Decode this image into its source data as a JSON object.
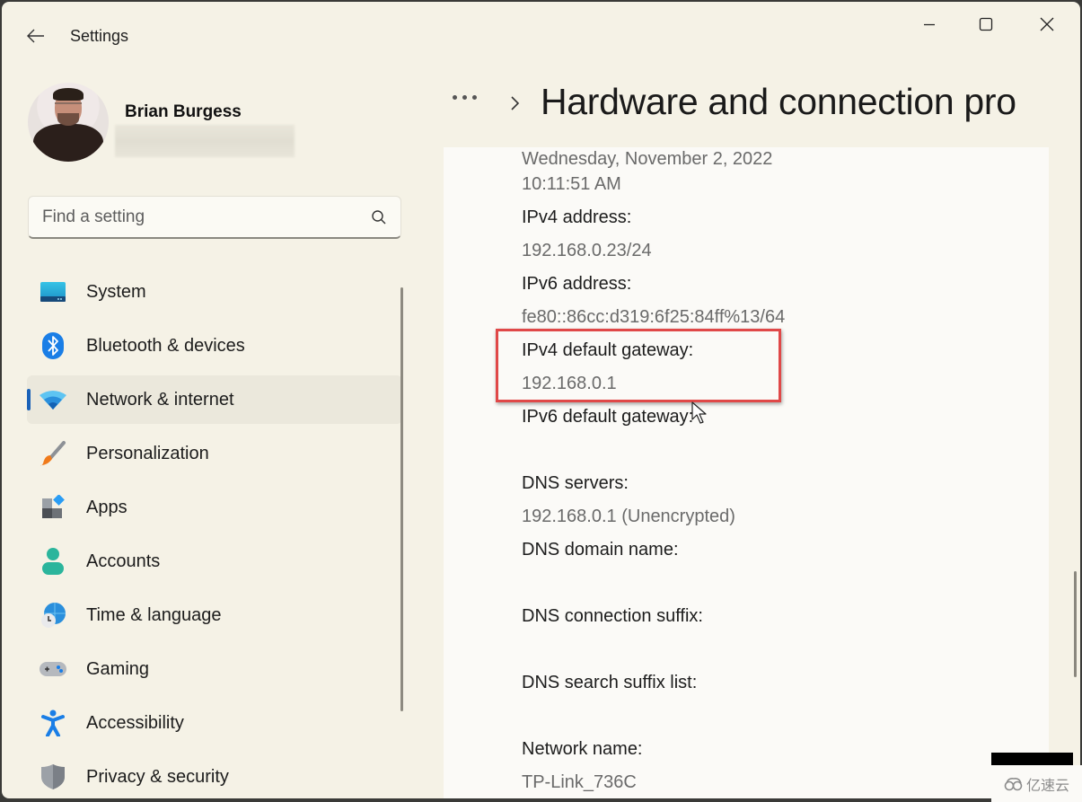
{
  "app": {
    "title": "Settings",
    "back_label": "Back",
    "window_controls": {
      "minimize": "minimize-icon",
      "maximize": "maximize-icon",
      "close": "close-icon"
    }
  },
  "profile": {
    "name": "Brian Burgess",
    "email": ""
  },
  "search": {
    "placeholder": "Find a setting",
    "value": ""
  },
  "sidebar": {
    "items": [
      {
        "label": "System",
        "icon": "monitor-icon",
        "active": false
      },
      {
        "label": "Bluetooth & devices",
        "icon": "bluetooth-icon",
        "active": false
      },
      {
        "label": "Network & internet",
        "icon": "wifi-icon",
        "active": true
      },
      {
        "label": "Personalization",
        "icon": "paintbrush-icon",
        "active": false
      },
      {
        "label": "Apps",
        "icon": "apps-icon",
        "active": false
      },
      {
        "label": "Accounts",
        "icon": "person-icon",
        "active": false
      },
      {
        "label": "Time & language",
        "icon": "globe-clock-icon",
        "active": false
      },
      {
        "label": "Gaming",
        "icon": "gamepad-icon",
        "active": false
      },
      {
        "label": "Accessibility",
        "icon": "accessibility-icon",
        "active": false
      },
      {
        "label": "Privacy & security",
        "icon": "shield-icon",
        "active": false
      }
    ]
  },
  "main": {
    "breadcrumb_more": "...",
    "title": "Hardware and connection pro",
    "properties": [
      {
        "label": "",
        "value": "Wednesday, November 2, 2022"
      },
      {
        "label": "",
        "value": "10:11:51 AM"
      },
      {
        "label": "IPv4 address:",
        "value": "192.168.0.23/24"
      },
      {
        "label": "IPv6 address:",
        "value": "fe80::86cc:d319:6f25:84ff%13/64"
      },
      {
        "label": "IPv4 default gateway:",
        "value": "192.168.0.1",
        "highlighted": true
      },
      {
        "label": "IPv6 default gateway:",
        "value": ""
      },
      {
        "label": "DNS servers:",
        "value": "192.168.0.1 (Unencrypted)"
      },
      {
        "label": "DNS domain name:",
        "value": ""
      },
      {
        "label": "DNS connection suffix:",
        "value": ""
      },
      {
        "label": "DNS search suffix list:",
        "value": ""
      },
      {
        "label": "Network name:",
        "value": "TP-Link_736C"
      }
    ]
  },
  "colors": {
    "accent": "#1a62b8",
    "highlight_box": "#e04848",
    "background": "#f5f2e6",
    "card": "#fbfaf7"
  },
  "watermark": {
    "text": "亿速云"
  }
}
